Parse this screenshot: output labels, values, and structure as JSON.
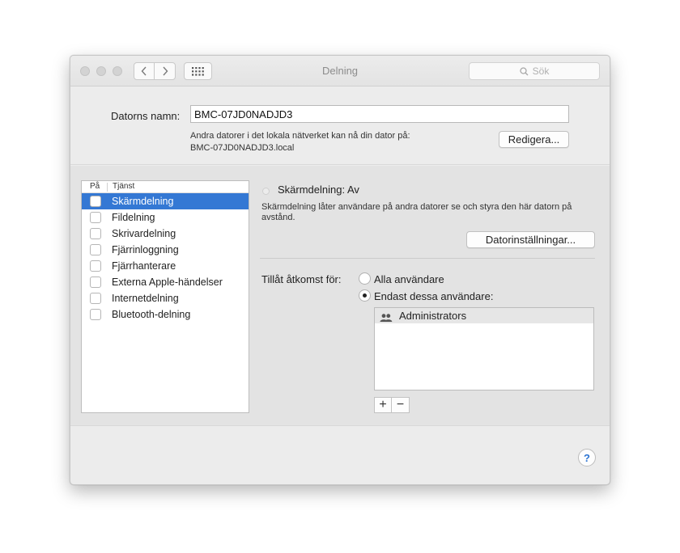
{
  "window": {
    "title": "Delning"
  },
  "search": {
    "placeholder": "Sök",
    "icon": "search-icon"
  },
  "computer_name": {
    "label": "Datorns namn:",
    "value": "BMC-07JD0NADJD3",
    "description_line1": "Andra datorer i det lokala nätverket kan nå din dator på:",
    "description_line2": "BMC-07JD0NADJD3.local",
    "edit_button": "Redigera..."
  },
  "services": {
    "col_on": "På",
    "col_service": "Tjänst",
    "items": [
      {
        "label": "Skärmdelning",
        "checked": false,
        "selected": true
      },
      {
        "label": "Fildelning",
        "checked": false,
        "selected": false
      },
      {
        "label": "Skrivardelning",
        "checked": false,
        "selected": false
      },
      {
        "label": "Fjärrinloggning",
        "checked": false,
        "selected": false
      },
      {
        "label": "Fjärrhanterare",
        "checked": false,
        "selected": false
      },
      {
        "label": "Externa Apple-händelser",
        "checked": false,
        "selected": false
      },
      {
        "label": "Internetdelning",
        "checked": false,
        "selected": false
      },
      {
        "label": "Bluetooth-delning",
        "checked": false,
        "selected": false
      }
    ]
  },
  "detail": {
    "status": "Skärmdelning: Av",
    "description": "Skärmdelning låter användare på andra datorer se och styra den här datorn på avstånd.",
    "settings_button": "Datorinställningar...",
    "access_label": "Tillåt åtkomst för:",
    "radio_all": "Alla användare",
    "radio_only": "Endast dessa användare:",
    "selected_radio": "only",
    "users": [
      "Administrators"
    ],
    "add_label": "+",
    "remove_label": "−"
  },
  "help": {
    "label": "?"
  },
  "colors": {
    "selection": "#3478d4",
    "help_accent": "#2d74d2"
  }
}
